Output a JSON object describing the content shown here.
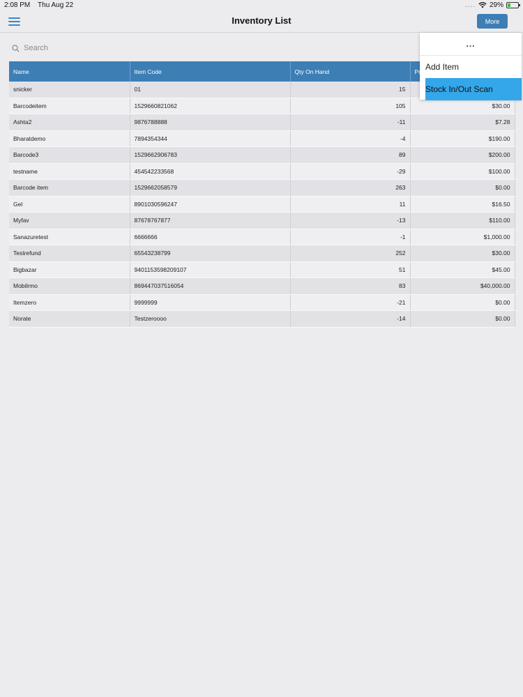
{
  "status": {
    "time": "2:08 PM",
    "date": "Thu Aug 22",
    "dots": "....",
    "battery": "29%"
  },
  "nav": {
    "title": "Inventory List",
    "more_label": "More"
  },
  "search": {
    "placeholder": "Search"
  },
  "table": {
    "columns": [
      "Name",
      "Item Code",
      "Qty On Hand",
      "Pr"
    ],
    "rows": [
      [
        "snicker",
        "01",
        "15",
        ""
      ],
      [
        "Barcodeitem",
        "1529660821062",
        "105",
        "$30.00"
      ],
      [
        "Ashta2",
        "9876788888",
        "-11",
        "$7.28"
      ],
      [
        "Bharatdemo",
        "7894354344",
        "-4",
        "$190.00"
      ],
      [
        "Barcode3",
        "1529662906783",
        "89",
        "$200.00"
      ],
      [
        "testname",
        "454542233568",
        "-29",
        "$100.00"
      ],
      [
        "Barcode item",
        "1529662058579",
        "263",
        "$0.00"
      ],
      [
        "Gel",
        "8901030596247",
        "11",
        "$16.50"
      ],
      [
        "Myfav",
        "87678767877",
        "-13",
        "$110.00"
      ],
      [
        "Sanazuretest",
        "6666666",
        "-1",
        "$1,000.00"
      ],
      [
        "Testrefund",
        "65543238799",
        "252",
        "$30.00"
      ],
      [
        "Bigbazar",
        "9401153598209107",
        "51",
        "$45.00"
      ],
      [
        "Mobilrmo",
        "869447037516054",
        "83",
        "$40,000.00"
      ],
      [
        "Itemzero",
        "9999999",
        "-21",
        "$0.00"
      ],
      [
        "Norate",
        "Testzeroooo",
        "-14",
        "$0.00"
      ]
    ]
  },
  "dropdown": {
    "header": "...",
    "items": [
      "Add Item",
      "Stock In/Out Scan"
    ]
  },
  "colors": {
    "accent": "#3d7eb5",
    "highlight": "#33a7ea"
  }
}
